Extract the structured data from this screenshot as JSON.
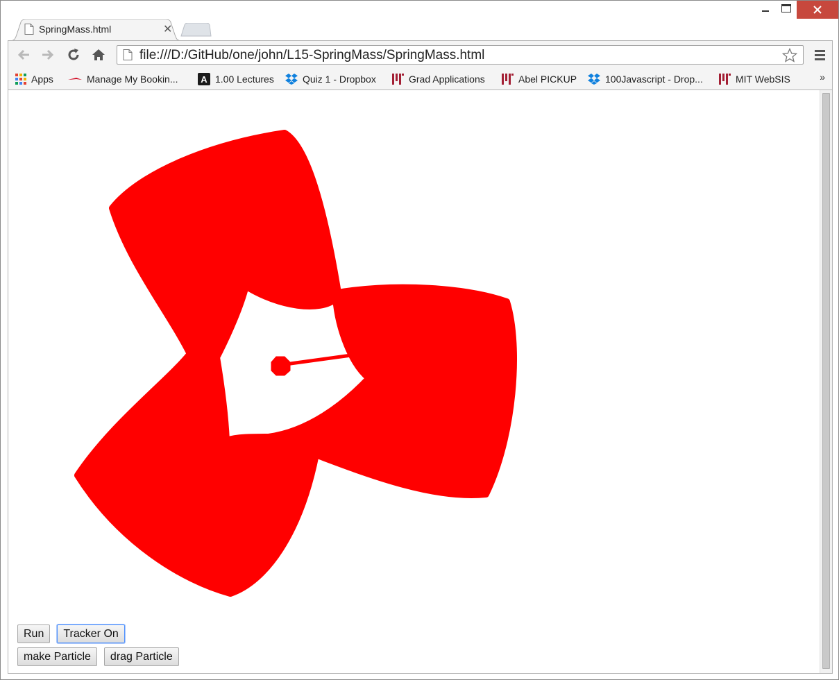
{
  "browser": {
    "tab": {
      "title": "SpringMass.html"
    },
    "address_bar": {
      "url": "file:///D:/GitHub/one/john/L15-SpringMass/SpringMass.html"
    },
    "bookmarks": [
      {
        "label": "Apps",
        "icon": "apps-grid-icon"
      },
      {
        "label": "Manage My Bookin...",
        "icon": "airline-icon"
      },
      {
        "label": "1.00 Lectures",
        "icon": "letter-a-icon"
      },
      {
        "label": "Quiz 1 - Dropbox",
        "icon": "dropbox-icon"
      },
      {
        "label": "Grad Applications",
        "icon": "mit-logo-icon"
      },
      {
        "label": "Abel PICKUP",
        "icon": "mit-logo-icon"
      },
      {
        "label": "100Javascript - Drop...",
        "icon": "dropbox-icon"
      },
      {
        "label": "MIT WebSIS",
        "icon": "mit-logo-icon"
      }
    ],
    "bookmarks_overflow": "»"
  },
  "page": {
    "simulation": {
      "color": "#ff0000"
    },
    "buttons": {
      "run": "Run",
      "tracker": "Tracker On",
      "make_particle": "make Particle",
      "drag_particle": "drag Particle"
    }
  },
  "colors": {
    "accent_red": "#ff0000",
    "close_button": "#c7483d",
    "focus_blue": "#4d90fe",
    "dropbox_blue": "#1081de",
    "mit_red": "#a31f34"
  }
}
